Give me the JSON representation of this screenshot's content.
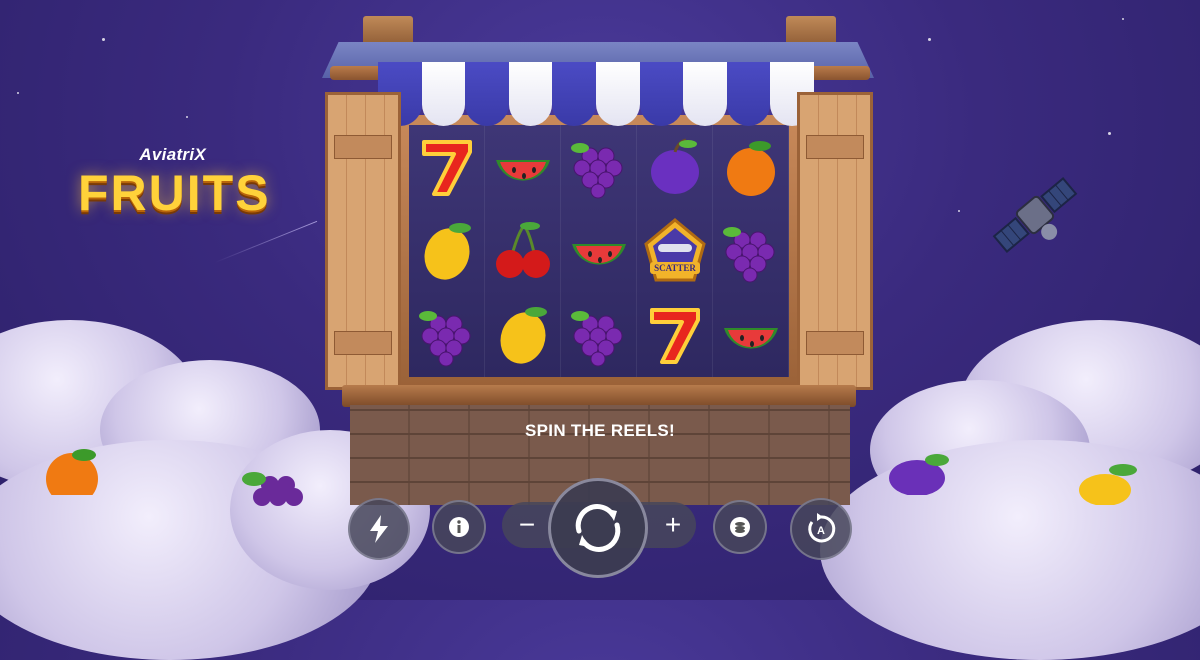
{
  "game": {
    "brand": "AviatriX",
    "title": "FRUITS",
    "status_message": "SPIN THE REELS!"
  },
  "reels": {
    "columns": 5,
    "rows": 3,
    "grid": [
      [
        "seven",
        "watermelon",
        "grapes",
        "plum",
        "orange"
      ],
      [
        "lemon",
        "cherries",
        "watermelon",
        "scatter",
        "grapes"
      ],
      [
        "grapes",
        "lemon",
        "grapes",
        "seven",
        "watermelon"
      ]
    ],
    "scatter_label": "SCATTER"
  },
  "controls": {
    "turbo_icon": "lightning-icon",
    "info_icon": "info-icon",
    "minus_label": "−",
    "plus_label": "+",
    "spin_icon": "refresh-arrows-icon",
    "bet_icon": "coin-stack-icon",
    "autoplay_icon": "autoplay-icon",
    "autoplay_label": "A"
  },
  "colors": {
    "sky": "#3a2a7e",
    "logo_gold": "#ffd23a",
    "awning_blue": "#3a3aa8",
    "wood": "#c8895a"
  }
}
